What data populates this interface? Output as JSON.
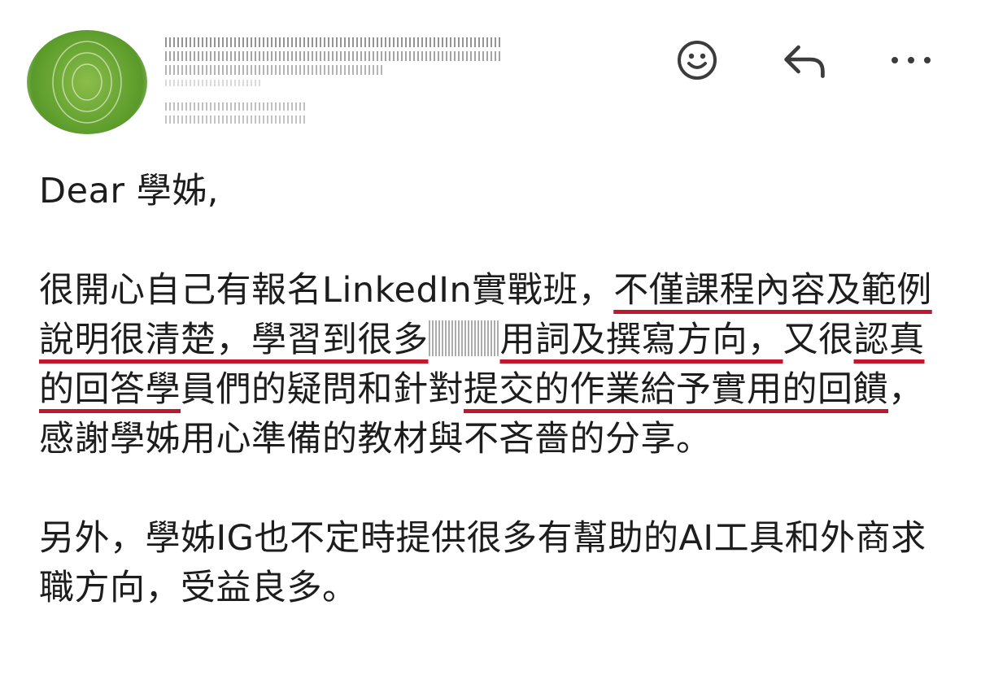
{
  "header": {
    "avatar_color": "#6aa634",
    "actions": [
      {
        "icon": "smiley-icon",
        "label": "React"
      },
      {
        "icon": "reply-icon",
        "label": "Reply"
      },
      {
        "icon": "more-icon",
        "label": "More"
      }
    ]
  },
  "message": {
    "greeting": "Dear 學姊,",
    "para1": {
      "t1": "很開心自己有報名LinkedIn實戰班，",
      "h1": "不僅課程內容及範例說明很清楚，學習到很多",
      "h1b": "用詞及撰寫方向，",
      "t2": "又很",
      "h2": "認真的回答學",
      "t3": "員們的疑問和針對",
      "h3": "提交的作業給予實用的回饋",
      "t4": "，感謝學姊用心準備的教材與不吝嗇的分享。"
    },
    "para2": "另外，學姊IG也不定時提供很多有幫助的AI工具和外商求職方向，受益良多。"
  },
  "colors": {
    "underline": "#c0182e",
    "text": "#1d1d1d",
    "icon": "#3c3c3c"
  }
}
